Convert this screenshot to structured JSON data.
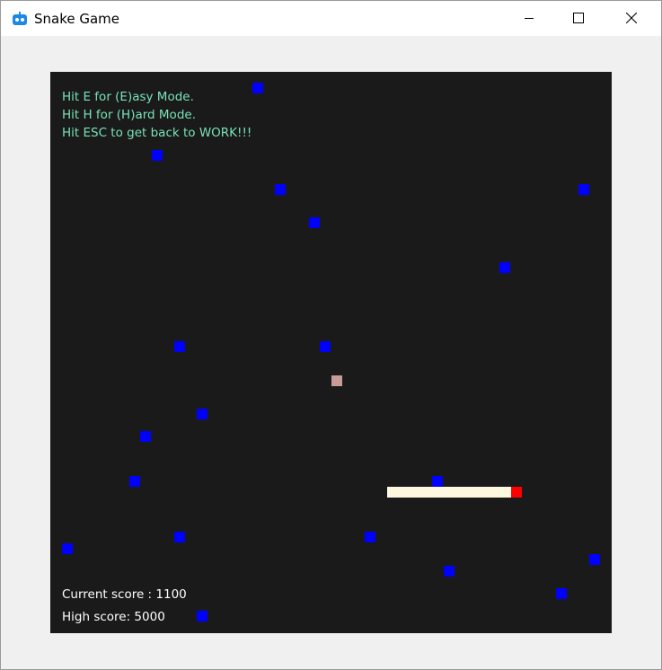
{
  "window": {
    "title": "Snake Game",
    "controls": {
      "minimize": "minimize-icon",
      "maximize": "maximize-icon",
      "close": "close-icon"
    }
  },
  "game": {
    "help": [
      "Hit E for (E)asy Mode.",
      "Hit H for (H)ard Mode.",
      "Hit ESC to get back to WORK!!!"
    ],
    "current_score": "Current score : 1100",
    "high_score": "High score: 5000",
    "colors": {
      "background": "#1a1a1a",
      "obstacle": "#0000ff",
      "food": "#c89a98",
      "snake_body": "#fff8e0",
      "snake_head": "#ff0000",
      "help_text": "#79e3b8"
    }
  }
}
